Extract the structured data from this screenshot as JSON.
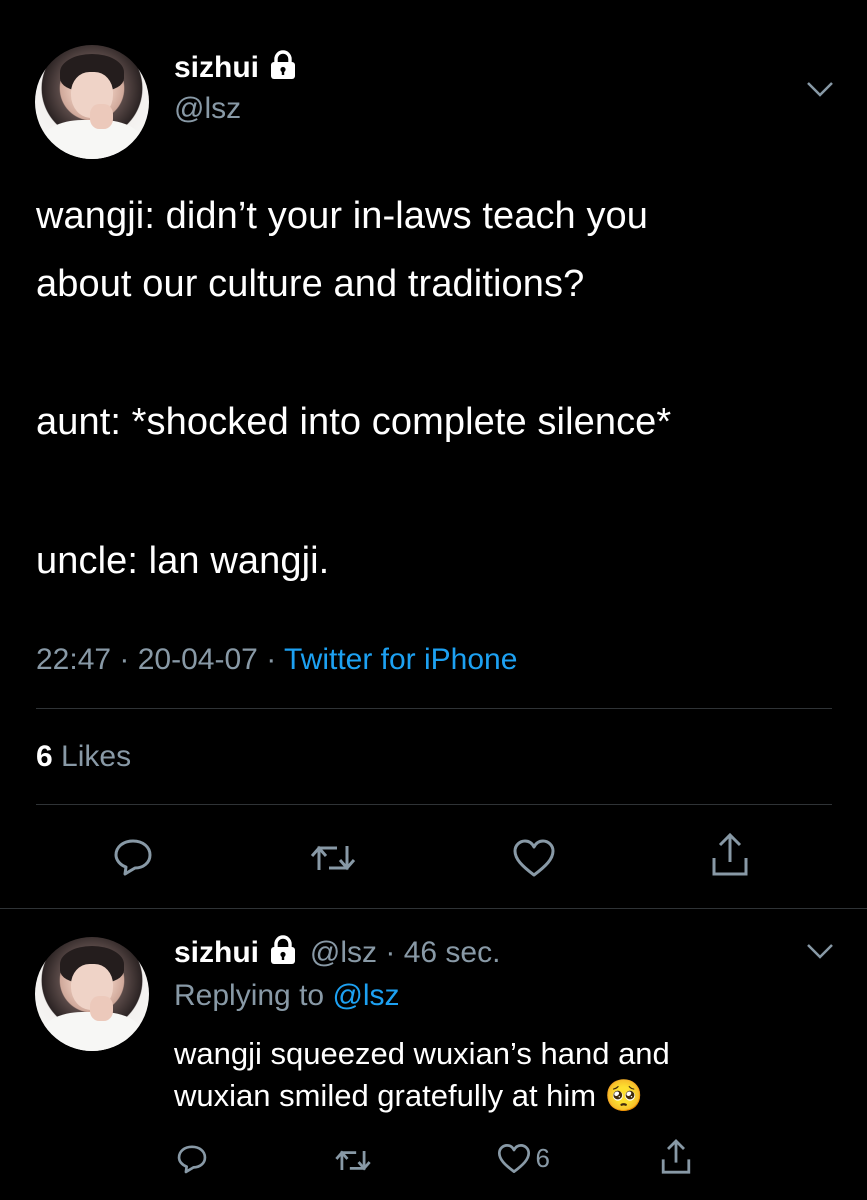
{
  "main_tweet": {
    "display_name": "sizhui",
    "handle": "@lsz",
    "lines": [
      "wangji: didn’t your in-laws teach you",
      "about our culture and traditions?",
      "aunt: *shocked into complete silence*",
      "uncle: lan wangji."
    ],
    "time": "22:47",
    "date": "20-04-07",
    "source": "Twitter for iPhone",
    "likes_count": "6",
    "likes_label": "Likes"
  },
  "reply_tweet": {
    "display_name": "sizhui",
    "handle": "@lsz",
    "age": "46 sec.",
    "replying_prefix": "Replying to",
    "replying_to": "@lsz",
    "lines": [
      "wangji squeezed wuxian’s hand and",
      "wuxian smiled gratefully at him"
    ],
    "emoji": "🥺",
    "like_count": "6"
  },
  "colors": {
    "background": "#000000",
    "muted": "#8899a6",
    "link": "#1da1f2",
    "divider": "#2f3336"
  },
  "icons": [
    "lock-icon",
    "chevron-down-icon",
    "reply-icon",
    "retweet-icon",
    "like-icon",
    "share-icon"
  ]
}
